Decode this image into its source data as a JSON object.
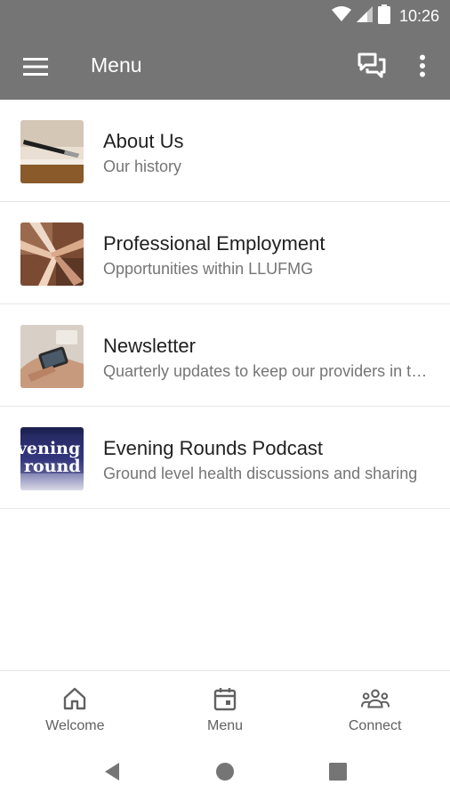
{
  "status_bar": {
    "time": "10:26",
    "icons": [
      "wifi-icon",
      "cell-signal-icon",
      "battery-icon"
    ]
  },
  "app_bar": {
    "title": "Menu",
    "icons": [
      "hamburger-menu-icon",
      "chat-icon",
      "more-vert-icon"
    ]
  },
  "colors": {
    "app_bar": "#757575",
    "title_text": "#212121",
    "subtitle_text": "#757575",
    "nav_icon": "#616161"
  },
  "menu_items": [
    {
      "title": "About Us",
      "subtitle": "Our history",
      "thumbnail": "pen-on-paper-image"
    },
    {
      "title": "Professional Employment",
      "subtitle": "Opportunities within LLUFMG",
      "thumbnail": "hands-together-image"
    },
    {
      "title": "Newsletter",
      "subtitle": "Quarterly updates to keep our providers in the loop",
      "thumbnail": "phone-in-hand-image"
    },
    {
      "title": "Evening Rounds Podcast",
      "subtitle": "Ground level health discussions and sharing",
      "thumbnail": "podcast-logo-image",
      "thumbnail_text": [
        "vening",
        "round"
      ]
    }
  ],
  "bottom_nav": [
    {
      "label": "Welcome",
      "icon": "home-icon"
    },
    {
      "label": "Menu",
      "icon": "calendar-icon"
    },
    {
      "label": "Connect",
      "icon": "people-icon"
    }
  ],
  "system_nav": [
    "back-icon",
    "home-circle-icon",
    "recents-icon"
  ]
}
